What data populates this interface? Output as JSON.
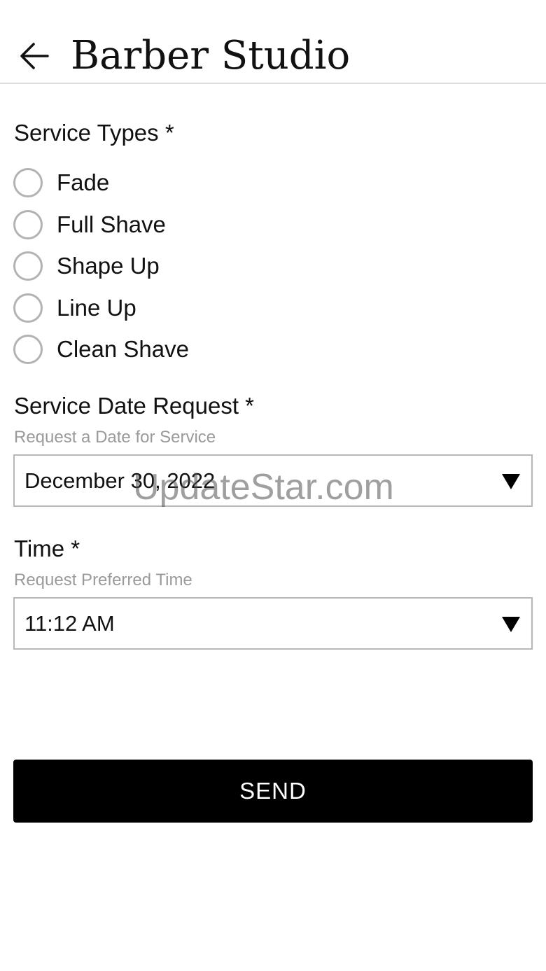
{
  "header": {
    "back_icon": "arrow-left-icon",
    "title": "Barber Studio"
  },
  "service_types": {
    "label": "Service Types *",
    "options": [
      {
        "label": "Fade",
        "selected": false
      },
      {
        "label": "Full Shave",
        "selected": false
      },
      {
        "label": "Shape Up",
        "selected": false
      },
      {
        "label": "Line Up",
        "selected": false
      },
      {
        "label": "Clean Shave",
        "selected": false
      }
    ]
  },
  "service_date": {
    "label": "Service Date Request *",
    "hint": "Request a Date for Service",
    "value": "December 30, 2022",
    "arrow_icon": "triangle-down-icon"
  },
  "time": {
    "label": "Time *",
    "hint": "Request Preferred Time",
    "value": "11:12 AM",
    "arrow_icon": "triangle-down-icon"
  },
  "send_label": "SEND",
  "watermark": "UpdateStar.com",
  "colors": {
    "button_bg": "#000000",
    "button_text": "#ffffff",
    "hint_text": "#9a9a9a",
    "radio_border": "#b3b3b3",
    "field_border": "#b8b8b8"
  }
}
